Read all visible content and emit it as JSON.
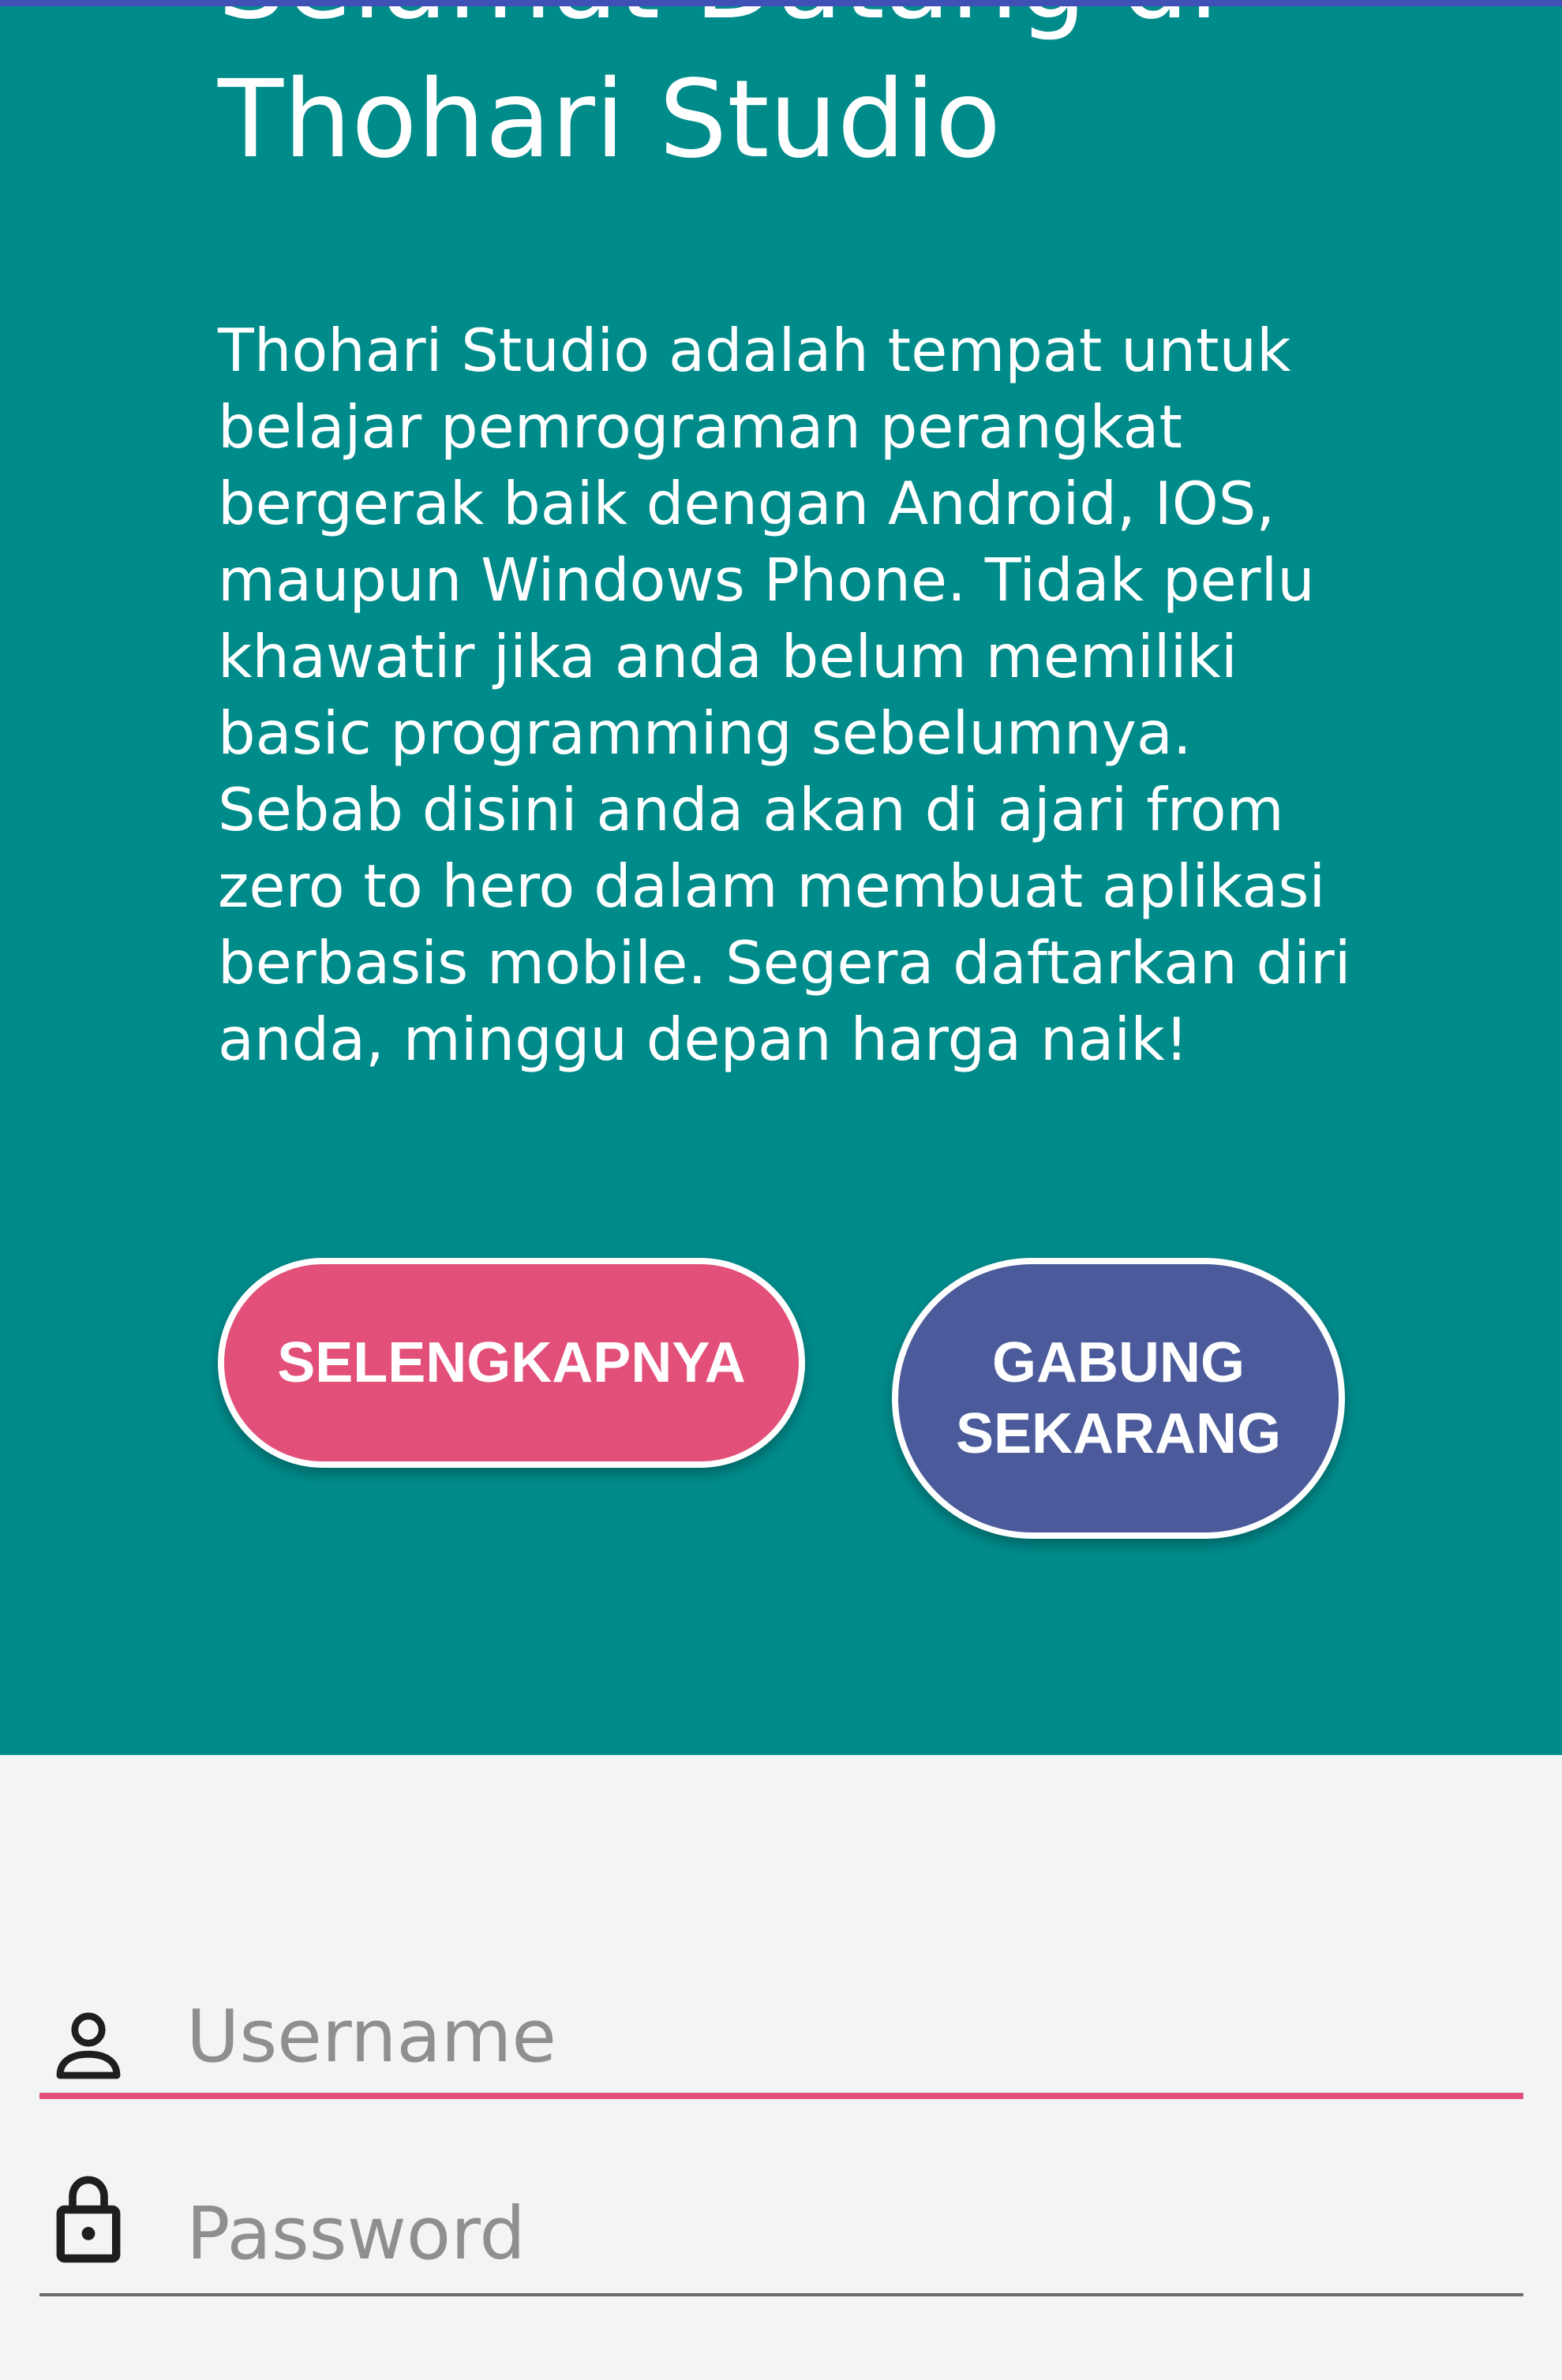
{
  "welcome": {
    "title_line1": "Selamat Datang di",
    "title_line2": "Thohari Studio",
    "description": "Thohari Studio adalah tempat untuk belajar pemrograman perangkat bergerak baik dengan Android, IOS, maupun Windows Phone. Tidak perlu khawatir jika anda belum memiliki basic programming sebelumnya. Sebab disini anda akan di ajari from zero to hero dalam membuat aplikasi berbasis mobile. Segera daftarkan diri anda, minggu depan harga naik!"
  },
  "buttons": {
    "more_label": "SELENGKAPNYA",
    "join_label_line1": "GABUNG",
    "join_label_line2": "SEKARANG"
  },
  "login": {
    "username_placeholder": "Username",
    "password_placeholder": "Password",
    "username_icon": "person-icon",
    "password_icon": "lock-icon"
  },
  "colors": {
    "hero_background": "#008b8b",
    "more_button": "#e2507a",
    "join_button": "#4a5a9a",
    "active_underline": "#e2507a",
    "page_background": "#f3f4f6"
  }
}
